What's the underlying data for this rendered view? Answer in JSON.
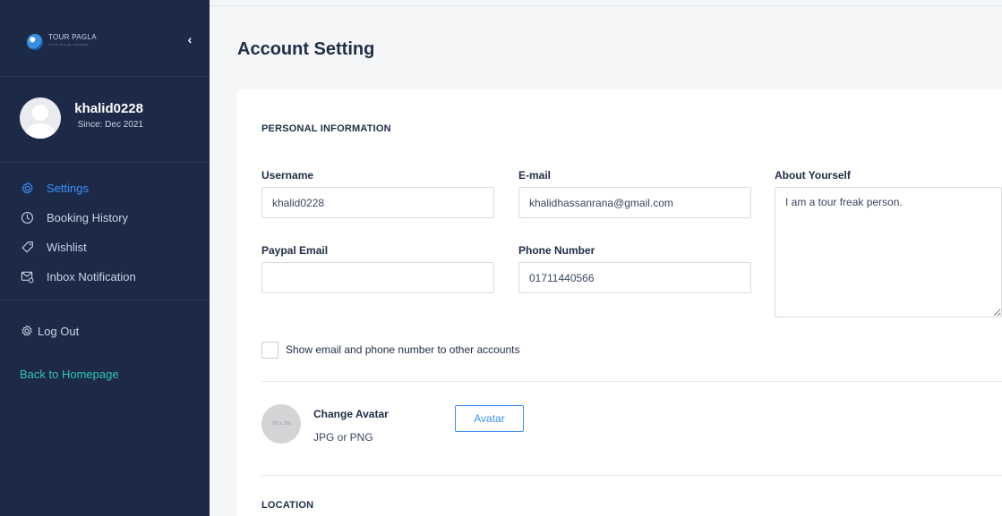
{
  "sidebar": {
    "logo": {
      "brand": "TOUR PAGLA",
      "tagline": "YOUR TRAVEL PARTNER",
      "icon": "globe-icon"
    },
    "collapse_icon": "chevron-left-icon",
    "collapse_glyph": "‹",
    "profile": {
      "username": "khalid0228",
      "since": "Since: Dec 2021"
    },
    "items": [
      {
        "label": "Settings",
        "icon": "gear-icon",
        "active": true
      },
      {
        "label": "Booking History",
        "icon": "clock-icon",
        "active": false
      },
      {
        "label": "Wishlist",
        "icon": "tag-heart-icon",
        "active": false
      },
      {
        "label": "Inbox Notification",
        "icon": "inbox-icon",
        "active": false
      }
    ],
    "logout": {
      "label": "Log Out",
      "icon": "gear-icon"
    },
    "homepage_link": "Back to Homepage"
  },
  "main": {
    "title": "Account Setting",
    "personal_section": "PERSONAL INFORMATION",
    "fields": {
      "username": {
        "label": "Username",
        "value": "khalid0228"
      },
      "email": {
        "label": "E-mail",
        "value": "khalidhassanrana@gmail.com"
      },
      "about": {
        "label": "About Yourself",
        "value": "I am a tour freak person."
      },
      "paypal": {
        "label": "Paypal Email",
        "value": ""
      },
      "phone": {
        "label": "Phone Number",
        "value": "01711440566"
      }
    },
    "show_contact": {
      "label": "Show email and phone number to other accounts",
      "checked": false
    },
    "avatar": {
      "placeholder_text": "200 x 200",
      "title": "Change Avatar",
      "formats": "JPG or PNG",
      "button": "Avatar"
    },
    "location_section": "LOCATION"
  },
  "colors": {
    "sidebar_bg": "#1c2a48",
    "accent": "#3d8ef7",
    "link_teal": "#2fc4b2",
    "page_bg": "#f5f6f8"
  }
}
